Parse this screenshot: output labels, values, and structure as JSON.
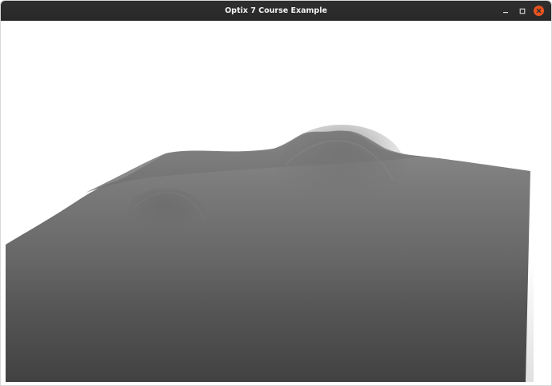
{
  "window": {
    "title": "Optix 7 Course Example",
    "controls": {
      "minimize_icon": "minimize-icon",
      "maximize_icon": "maximize-icon",
      "close_icon": "close-icon"
    }
  },
  "render": {
    "background_color": "#ffffff",
    "terrain_colors": [
      "#8a8a8a",
      "#7a7a7a",
      "#6a6a6a",
      "#585858",
      "#4a4a4a"
    ]
  },
  "colors": {
    "titlebar": "#2c2c2c",
    "close_button": "#e95420"
  }
}
